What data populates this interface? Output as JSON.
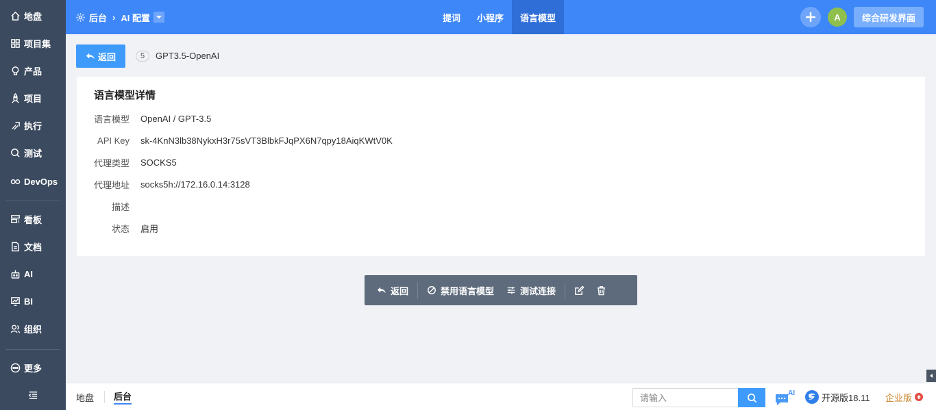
{
  "sidebar": {
    "items": [
      {
        "label": "地盘",
        "icon": "home-icon"
      },
      {
        "label": "项目集",
        "icon": "grid-icon"
      },
      {
        "label": "产品",
        "icon": "lightbulb-icon"
      },
      {
        "label": "项目",
        "icon": "rocket-icon"
      },
      {
        "label": "执行",
        "icon": "run-icon"
      },
      {
        "label": "测试",
        "icon": "search-check-icon"
      },
      {
        "label": "DevOps",
        "icon": "infinity-icon"
      },
      {
        "label": "看板",
        "icon": "kanban-icon"
      },
      {
        "label": "文档",
        "icon": "document-icon"
      },
      {
        "label": "AI",
        "icon": "robot-icon"
      },
      {
        "label": "BI",
        "icon": "chart-icon"
      },
      {
        "label": "组织",
        "icon": "users-icon"
      },
      {
        "label": "更多",
        "icon": "more-icon"
      }
    ],
    "collapse_icon": "menu-collapse-icon"
  },
  "header": {
    "breadcrumb": {
      "root": "后台",
      "current": "AI 配置"
    },
    "tabs": [
      {
        "label": "提词",
        "active": false
      },
      {
        "label": "小程序",
        "active": false
      },
      {
        "label": "语言模型",
        "active": true
      }
    ],
    "avatar_initial": "A",
    "switch_button": "综合研发界面",
    "accent": "#3e87f8"
  },
  "main": {
    "back_label": "返回",
    "item_id": "5",
    "item_name": "GPT3.5-OpenAI",
    "card": {
      "title": "语言模型详情",
      "fields": [
        {
          "label": "语言模型",
          "value": "OpenAI / GPT-3.5"
        },
        {
          "label": "API Key",
          "value": "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"
        },
        {
          "label": "代理类型",
          "value": "SOCKS5"
        },
        {
          "label": "代理地址",
          "value": "socks5h://172.16.0.14:3128"
        },
        {
          "label": "描述",
          "value": ""
        },
        {
          "label": "状态",
          "value": "启用"
        }
      ]
    },
    "toolbar": {
      "back": "返回",
      "disable": "禁用语言模型",
      "test": "测试连接"
    }
  },
  "footer": {
    "links": [
      {
        "label": "地盘",
        "active": false
      },
      {
        "label": "后台",
        "active": true
      }
    ],
    "search_placeholder": "请输入",
    "ai_badge": "AI",
    "version": "开源版18.11",
    "edition": "企业版"
  }
}
